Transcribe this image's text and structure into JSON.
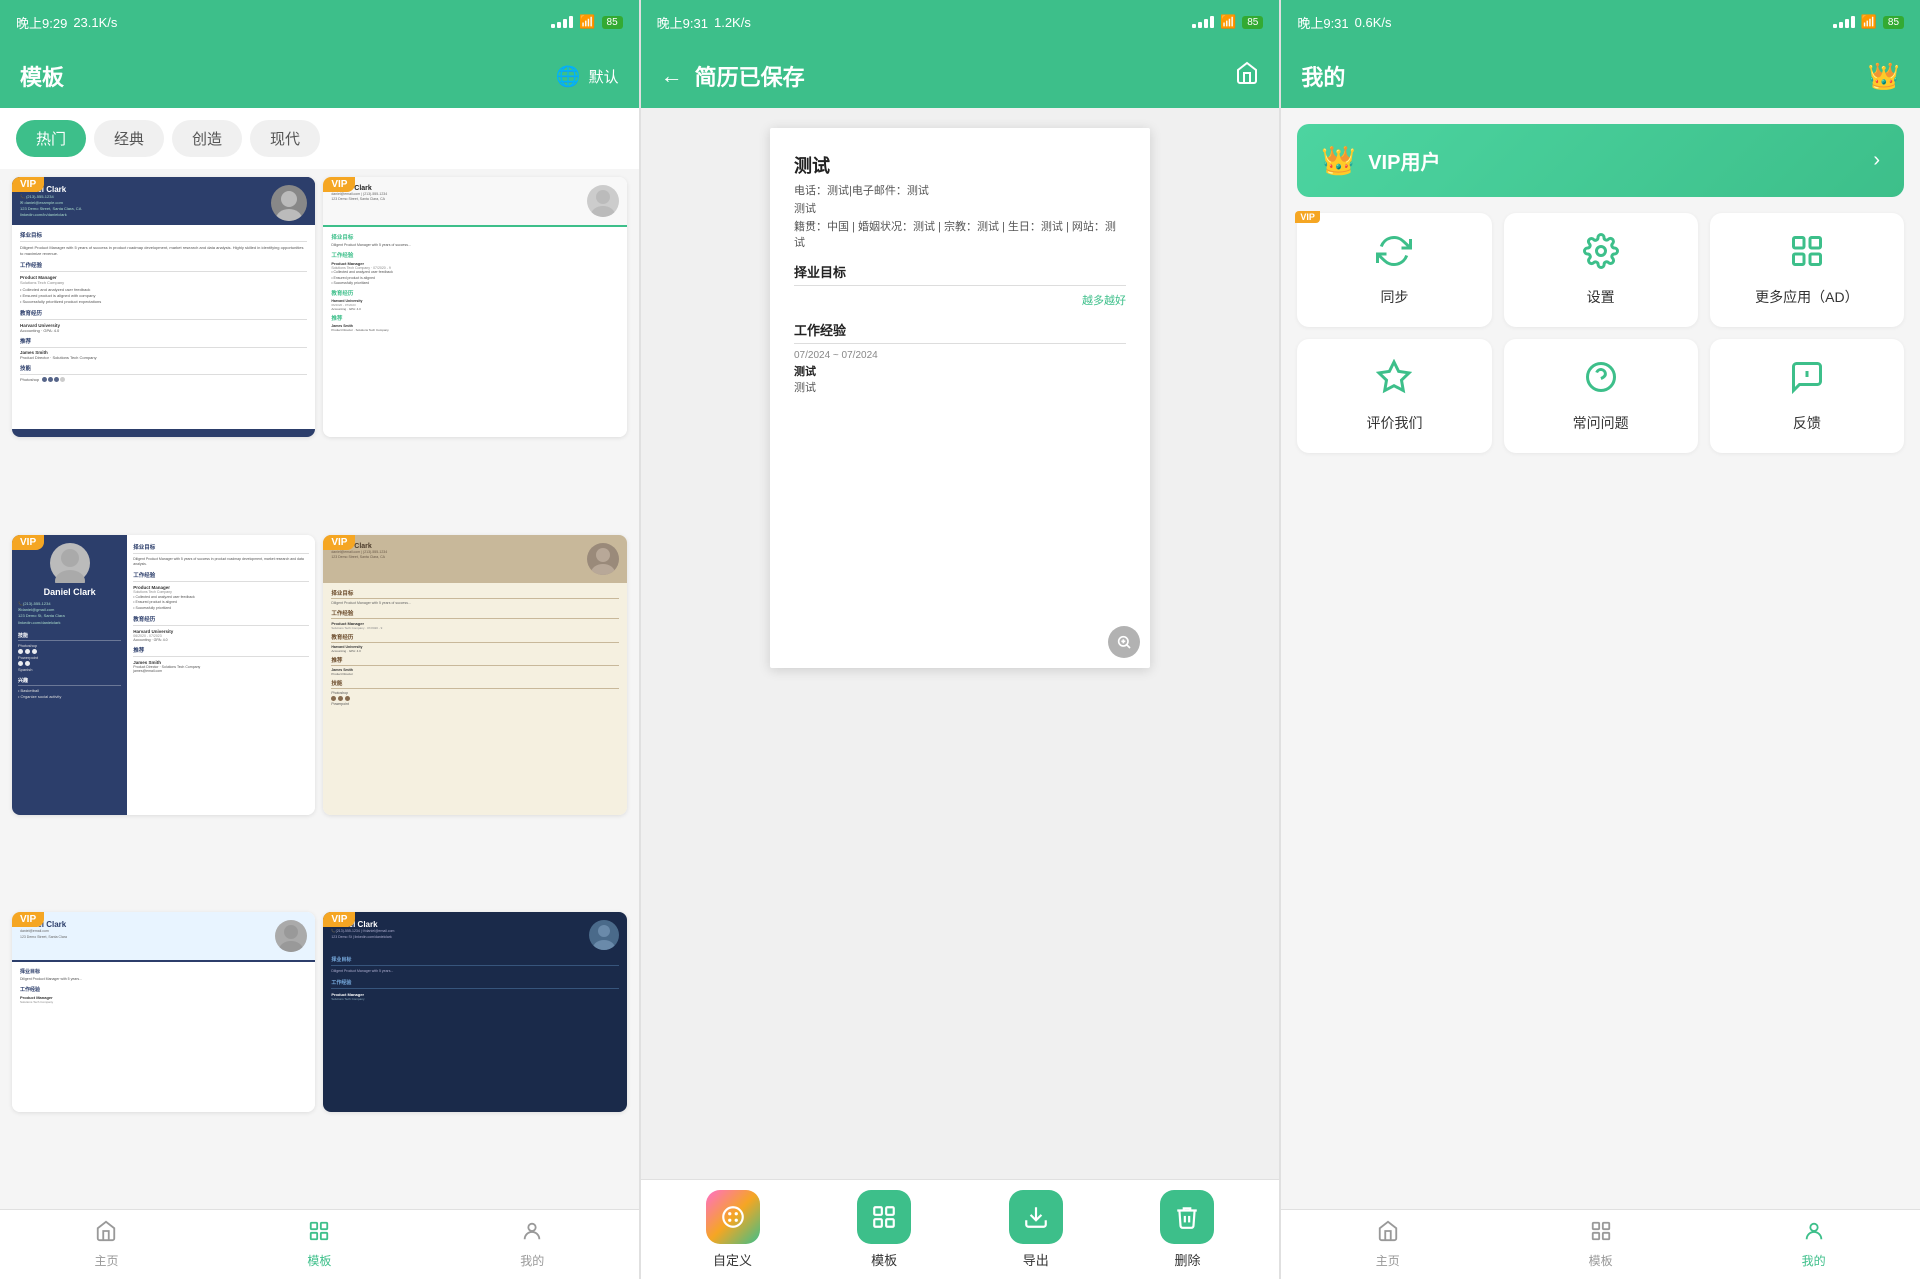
{
  "panels": [
    {
      "id": "templates",
      "statusBar": {
        "time": "晚上9:29",
        "speed": "23.1K/s"
      },
      "header": {
        "title": "模板",
        "rightLabel": "默认",
        "rightIcon": "globe"
      },
      "filterTabs": [
        "热门",
        "经典",
        "创造",
        "现代"
      ],
      "activeTab": 0,
      "templates": [
        {
          "style": "dark-blue",
          "vip": true,
          "name": "Daniel Clark"
        },
        {
          "style": "light",
          "vip": true,
          "name": "Daniel Clark"
        },
        {
          "style": "light-left",
          "vip": true,
          "name": "Daniel Clark"
        },
        {
          "style": "cream",
          "vip": true,
          "name": "Daniel Clark"
        },
        {
          "style": "dark-blue",
          "vip": true,
          "name": "Daniel Clark"
        },
        {
          "style": "dark-blue2",
          "vip": true,
          "name": "Daniel Clark"
        }
      ],
      "tabBar": [
        {
          "icon": "home",
          "label": "主页",
          "active": false
        },
        {
          "icon": "template",
          "label": "模板",
          "active": true
        },
        {
          "icon": "person",
          "label": "我的",
          "active": false
        }
      ]
    },
    {
      "id": "resume-saved",
      "statusBar": {
        "time": "晚上9:31",
        "speed": "1.2K/s"
      },
      "header": {
        "backIcon": "back",
        "title": "简历已保存",
        "rightIcon": "home"
      },
      "resume": {
        "name": "测试",
        "contactLine1": "电话：测试|电子邮件：测试",
        "contactLine2": "测试",
        "contactLine3": "籍贯：中国 | 婚姻状况：测试 | 宗教：测试 | 生日：测试 | 网站：测试",
        "sections": [
          {
            "title": "择业目标",
            "content": "越多越好"
          },
          {
            "title": "工作经验",
            "entries": [
              {
                "period": "07/2024 ~ 07/2024",
                "title": "测试",
                "company": "测试"
              }
            ]
          }
        ]
      },
      "actions": [
        {
          "icon": "palette",
          "label": "自定义",
          "color": "#e84393",
          "gradient": true
        },
        {
          "icon": "template",
          "label": "模板",
          "color": "#3dbf8a"
        },
        {
          "icon": "download",
          "label": "导出",
          "color": "#3dbf8a"
        },
        {
          "icon": "trash",
          "label": "删除",
          "color": "#3dbf8a"
        }
      ]
    },
    {
      "id": "my",
      "statusBar": {
        "time": "晚上9:31",
        "speed": "0.6K/s"
      },
      "header": {
        "title": "我的",
        "rightIcon": "crown"
      },
      "vipCard": {
        "label": "VIP用户",
        "icon": "crown"
      },
      "menuRows": [
        [
          {
            "icon": "sync",
            "label": "同步",
            "vip": true
          },
          {
            "icon": "settings",
            "label": "设置",
            "vip": false
          },
          {
            "icon": "apps",
            "label": "更多应用（AD）",
            "vip": false
          }
        ],
        [
          {
            "icon": "star",
            "label": "评价我们",
            "vip": false
          },
          {
            "icon": "help",
            "label": "常问问题",
            "vip": false
          },
          {
            "icon": "feedback",
            "label": "反馈",
            "vip": false
          }
        ]
      ],
      "tabBar": [
        {
          "icon": "home",
          "label": "主页",
          "active": false
        },
        {
          "icon": "template",
          "label": "模板",
          "active": false
        },
        {
          "icon": "person",
          "label": "我的",
          "active": true
        }
      ]
    }
  ]
}
